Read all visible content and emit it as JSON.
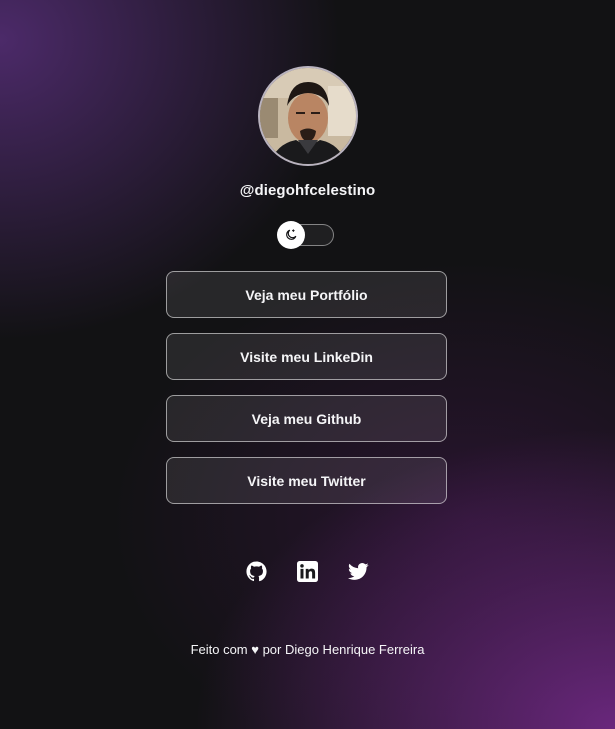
{
  "profile": {
    "username": "@diegohfcelestino",
    "avatar_alt": "Diego"
  },
  "theme_switch": {
    "mode": "dark",
    "icon": "moon-icon"
  },
  "links": [
    {
      "label": "Veja meu Portfólio"
    },
    {
      "label": "Visite meu LinkeDin"
    },
    {
      "label": "Veja meu Github"
    },
    {
      "label": "Visite meu Twitter"
    }
  ],
  "socials": [
    {
      "icon": "github-icon"
    },
    {
      "icon": "linkedin-icon"
    },
    {
      "icon": "twitter-icon"
    }
  ],
  "footer": {
    "text": "Feito com ♥ por Diego Henrique Ferreira"
  },
  "colors": {
    "background": "#121214",
    "accent_purple": "#6e2882",
    "text": "#f5f5f7"
  }
}
